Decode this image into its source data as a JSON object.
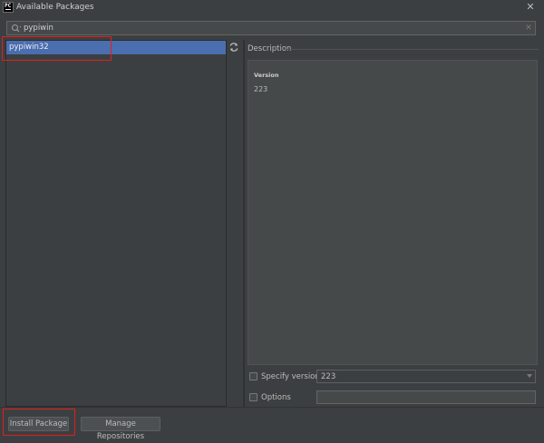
{
  "window": {
    "title": "Available Packages",
    "app_icon": "pycharm-icon",
    "app_icon_text": "PC"
  },
  "search": {
    "value": "pypiwin",
    "icon": "search-icon"
  },
  "packages": {
    "items": [
      {
        "name": "pypiwin32",
        "selected": true
      }
    ]
  },
  "description": {
    "label": "Description",
    "version_title": "Version",
    "version_value": "223"
  },
  "options": {
    "specify_version_label": "Specify version",
    "specify_version_checked": false,
    "version_selected": "223",
    "options_label": "Options",
    "options_checked": false,
    "options_value": ""
  },
  "buttons": {
    "install": "Install Package",
    "manage": "Manage Repositories"
  },
  "colors": {
    "background": "#3c3f41",
    "selection": "#4b6eaf",
    "annotation": "#e02020"
  }
}
